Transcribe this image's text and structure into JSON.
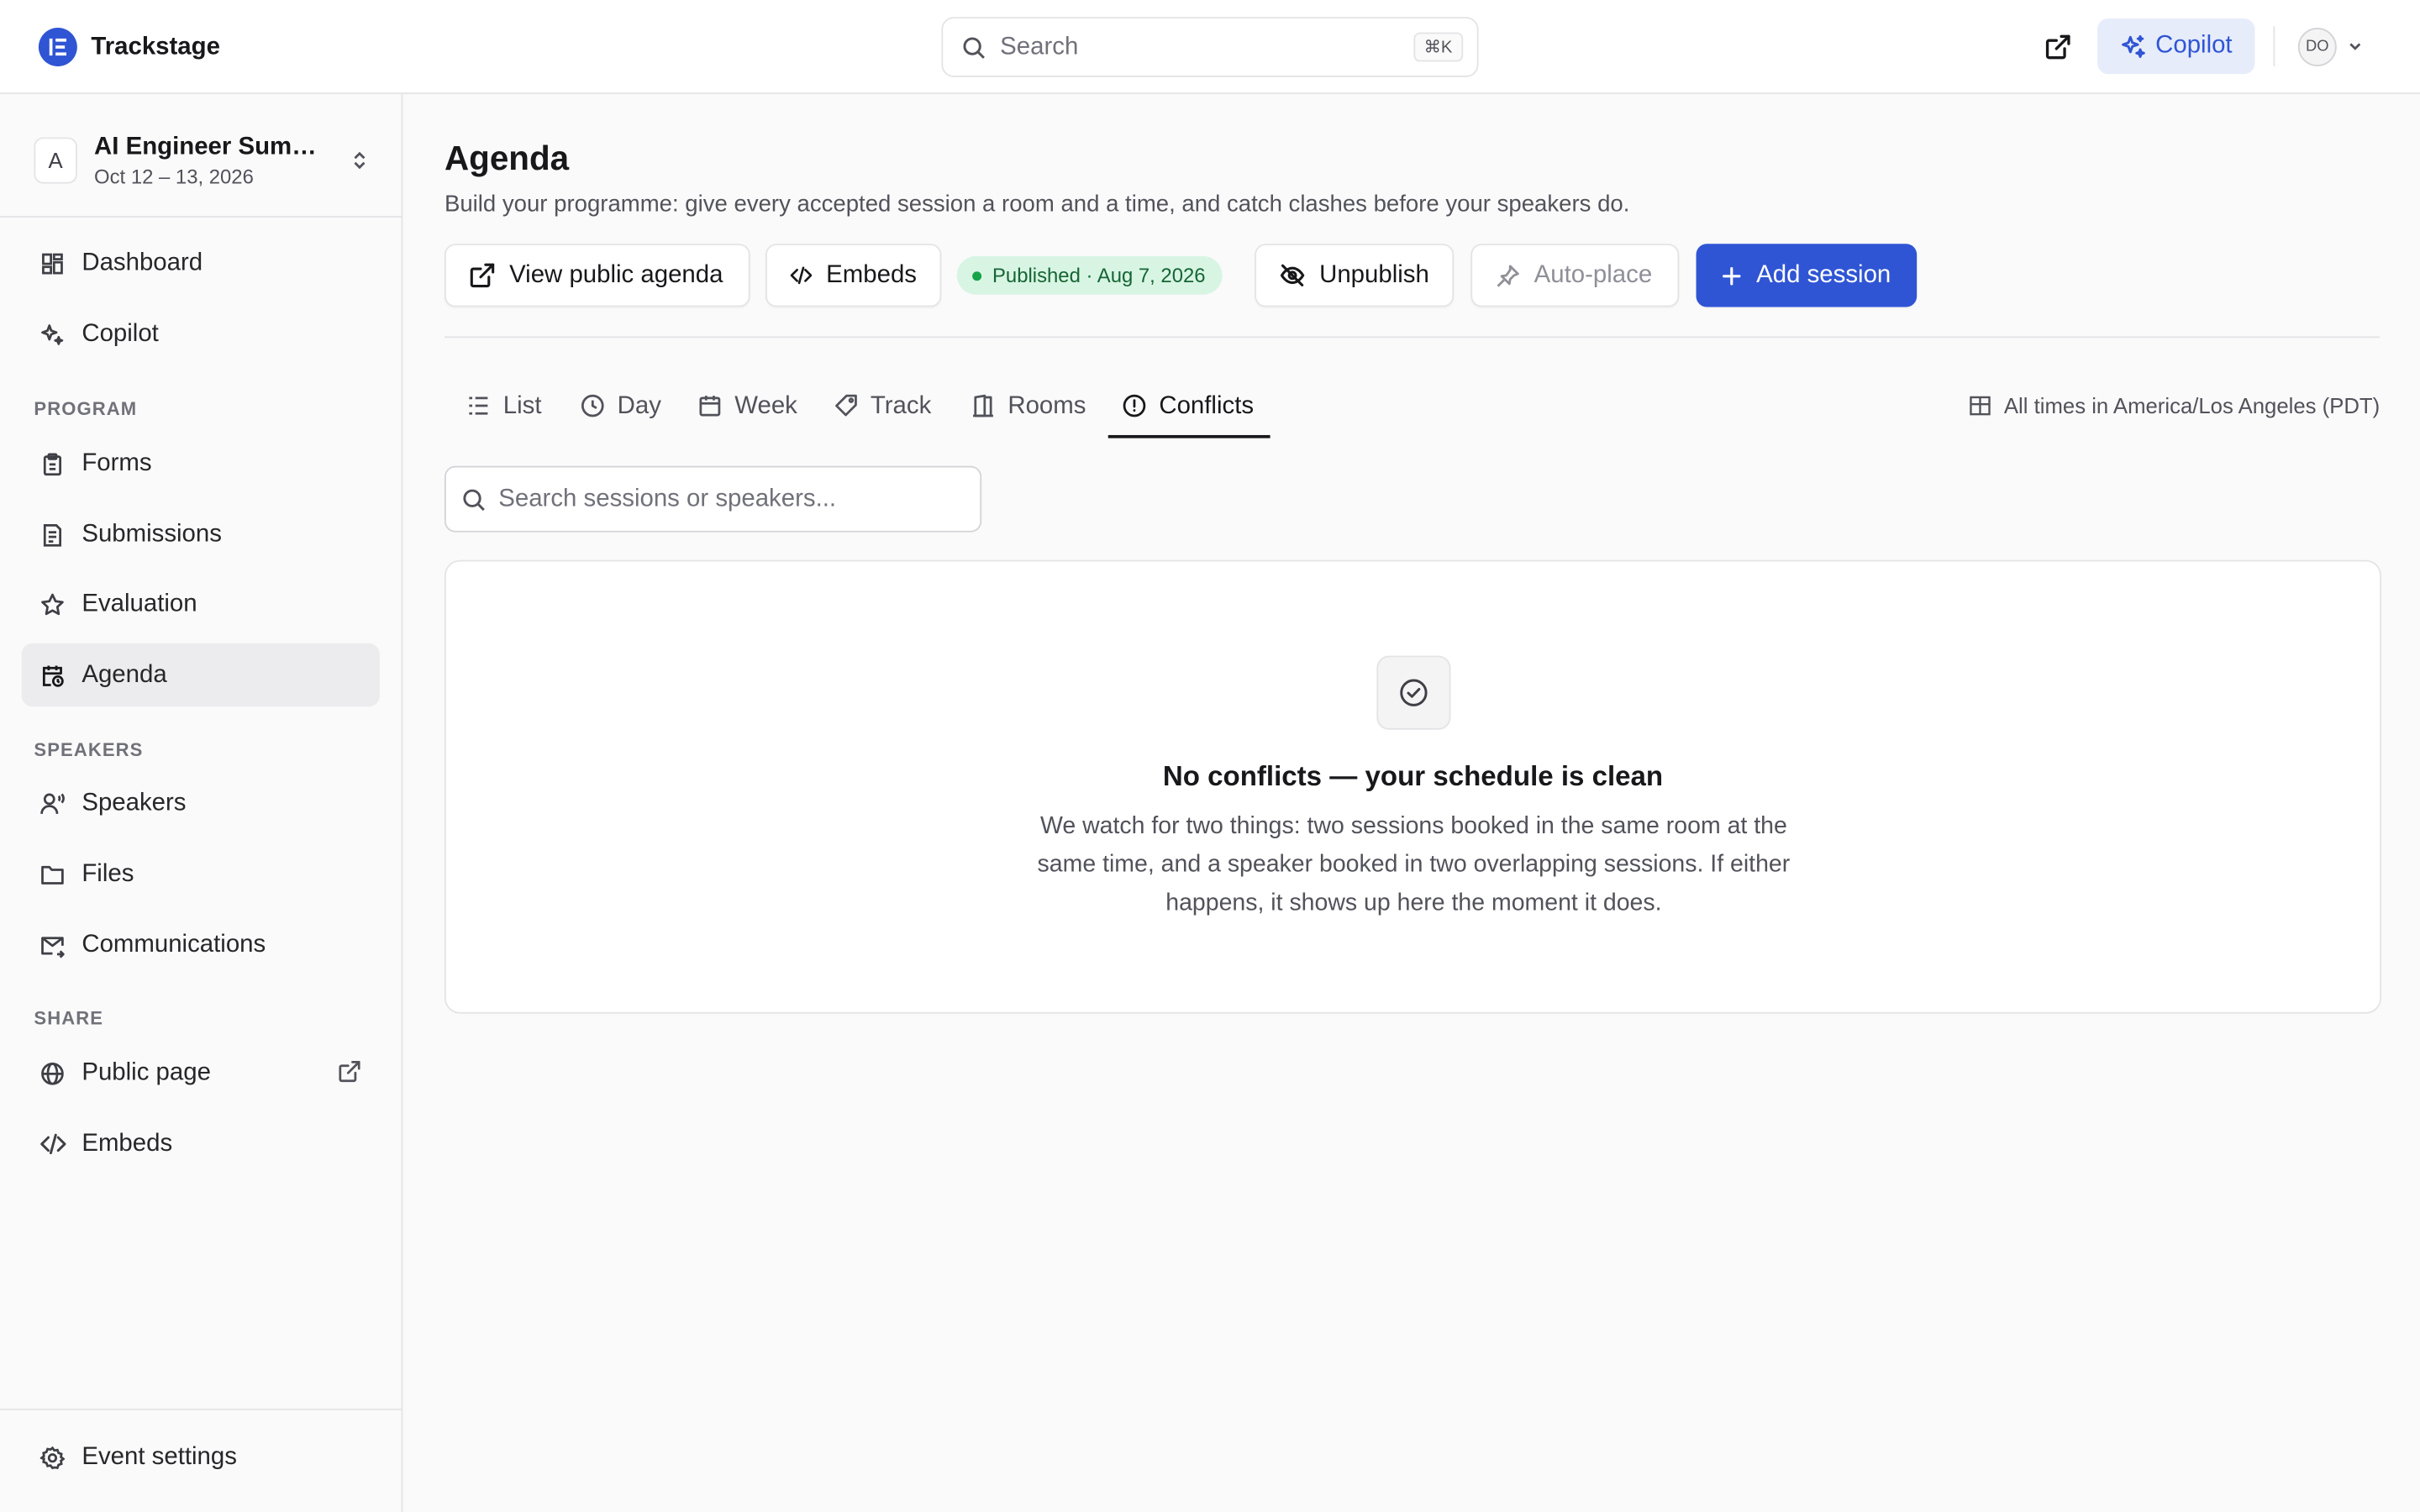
{
  "app": {
    "name": "Trackstage"
  },
  "header": {
    "search_placeholder": "Search",
    "search_shortcut": "⌘K",
    "copilot_label": "Copilot",
    "avatar_initials": "DO"
  },
  "event": {
    "initial": "A",
    "name": "AI Engineer Summ...",
    "dates": "Oct 12 – 13, 2026"
  },
  "sidebar": {
    "top": [
      {
        "label": "Dashboard",
        "icon": "dashboard-icon"
      },
      {
        "label": "Copilot",
        "icon": "sparkle-icon"
      }
    ],
    "program_label": "PROGRAM",
    "program": [
      {
        "label": "Forms",
        "icon": "clipboard-icon"
      },
      {
        "label": "Submissions",
        "icon": "document-list-icon"
      },
      {
        "label": "Evaluation",
        "icon": "star-icon"
      },
      {
        "label": "Agenda",
        "icon": "calendar-clock-icon",
        "active": true
      }
    ],
    "speakers_label": "SPEAKERS",
    "speakers": [
      {
        "label": "Speakers",
        "icon": "speaker-icon"
      },
      {
        "label": "Files",
        "icon": "folder-icon"
      },
      {
        "label": "Communications",
        "icon": "mail-send-icon"
      }
    ],
    "share_label": "SHARE",
    "share": [
      {
        "label": "Public page",
        "icon": "globe-icon"
      },
      {
        "label": "Embeds",
        "icon": "code-icon"
      }
    ],
    "footer": {
      "label": "Event settings",
      "icon": "gear-icon"
    }
  },
  "page": {
    "title": "Agenda",
    "subtitle": "Build your programme: give every accepted session a room and a time, and catch clashes before your speakers do.",
    "actions": {
      "view_public": "View public agenda",
      "embeds": "Embeds",
      "status": "Published · Aug 7, 2026",
      "unpublish": "Unpublish",
      "autoplace": "Auto-place",
      "add_session": "Add session"
    },
    "tabs": [
      {
        "label": "List",
        "icon": "list-icon"
      },
      {
        "label": "Day",
        "icon": "clock-icon"
      },
      {
        "label": "Week",
        "icon": "calendar-icon"
      },
      {
        "label": "Track",
        "icon": "tag-icon"
      },
      {
        "label": "Rooms",
        "icon": "door-icon"
      },
      {
        "label": "Conflicts",
        "icon": "alert-circle-icon",
        "active": true
      }
    ],
    "timezone": "All times in America/Los Angeles (PDT)",
    "search_placeholder": "Search sessions or speakers...",
    "empty": {
      "title": "No conflicts — your schedule is clean",
      "text": "We watch for two things: two sessions booked in the same room at the same time, and a speaker booked in two overlapping sessions. If either happens, it shows up here the moment it does."
    }
  },
  "colors": {
    "accent": "#2f55d4",
    "success": "#16a34a",
    "success_bg": "#d8f5e4"
  }
}
